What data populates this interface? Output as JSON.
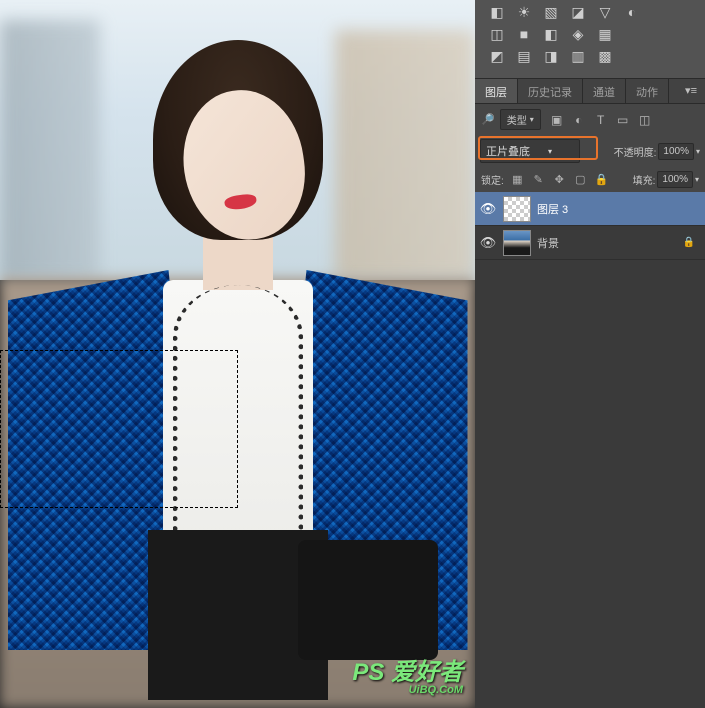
{
  "top_icon_rows": [
    [
      "eyedropper-icon",
      "ruler-icon",
      "note-icon",
      "counter-icon",
      "color-sampler-icon",
      "measure-icon"
    ],
    [
      "brightness-icon",
      "levels-icon",
      "curves-icon",
      "exposure-icon",
      "vibrance-icon"
    ],
    [
      "hue-icon",
      "bw-icon",
      "photo-filter-icon",
      "channel-mixer-icon",
      "color-lookup-icon"
    ],
    [
      "invert-icon",
      "posterize-icon",
      "threshold-icon",
      "gradient-map-icon",
      "selective-color-icon"
    ]
  ],
  "tabs": {
    "layers": "图层",
    "history": "历史记录",
    "channels": "通道",
    "actions": "动作"
  },
  "filter_row": {
    "kind_label": "类型",
    "search_icon": "search"
  },
  "blend_mode": {
    "value": "正片叠底",
    "opacity_label": "不透明度:",
    "opacity_value": "100%"
  },
  "lock_row": {
    "label": "锁定:",
    "fill_label": "填充:",
    "fill_value": "100%"
  },
  "layers": [
    {
      "name": "图层 3",
      "selected": true,
      "thumb": "checker",
      "locked": false
    },
    {
      "name": "背景",
      "selected": false,
      "thumb": "photo",
      "locked": true
    }
  ],
  "watermark": {
    "main": "PS 爱好者",
    "sub": "UiBQ.CoM"
  }
}
